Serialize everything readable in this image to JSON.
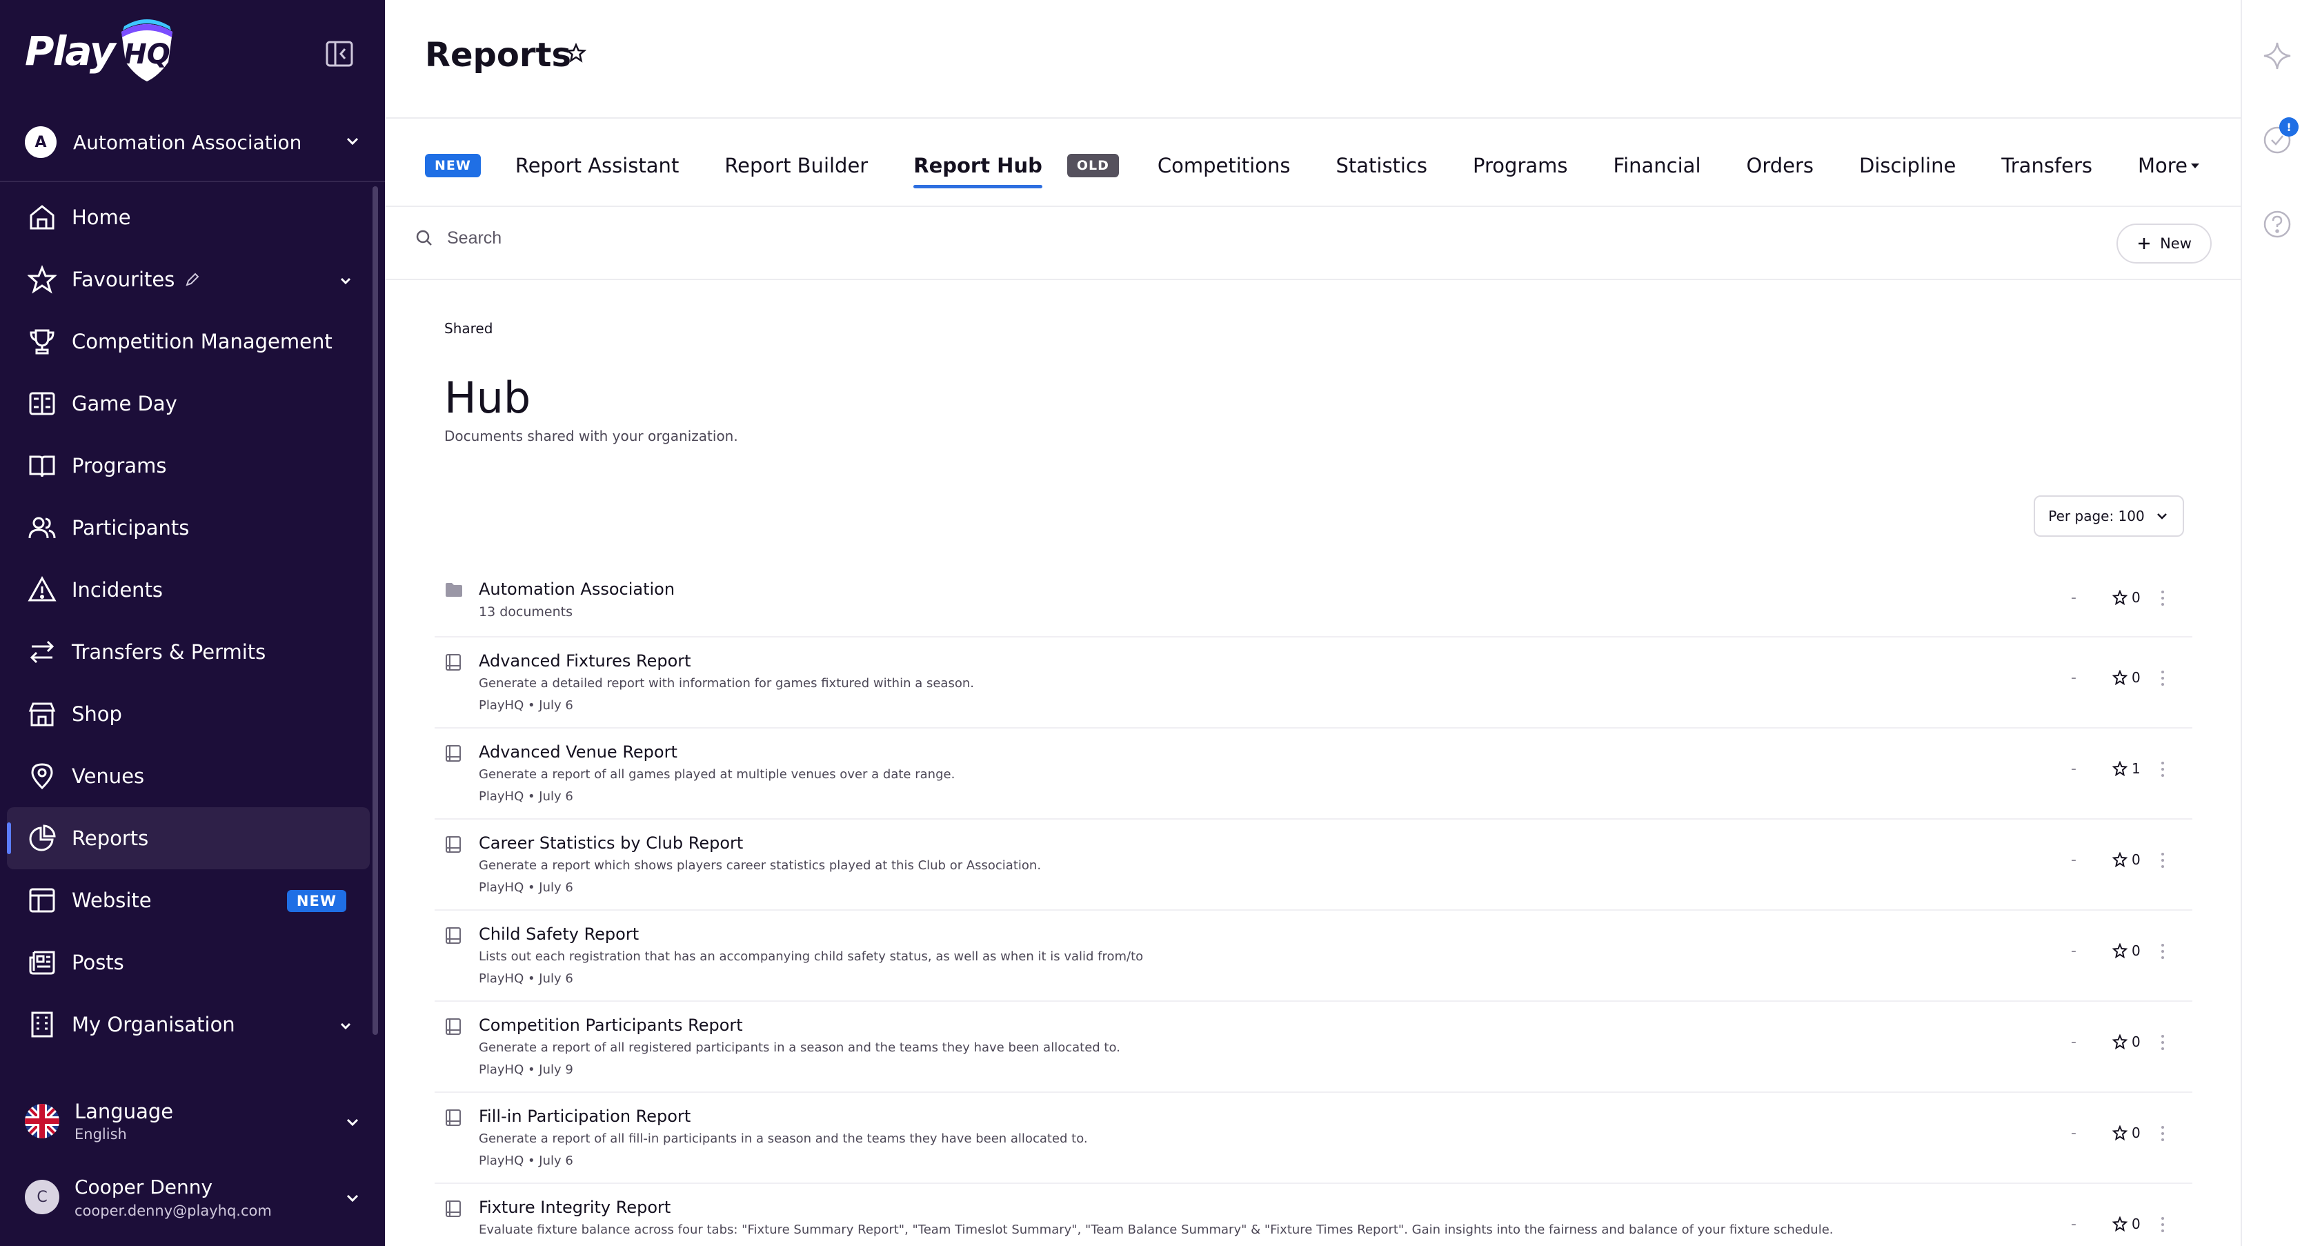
{
  "app": {
    "logo_text": "Play",
    "logo_mark": "HQ"
  },
  "sidebar": {
    "org": {
      "initial": "A",
      "name": "Automation Association"
    },
    "items": [
      {
        "label": "Home",
        "icon": "home-icon"
      },
      {
        "label": "Favourites",
        "icon": "star-icon"
      },
      {
        "label": "Competition Management",
        "icon": "trophy-icon"
      },
      {
        "label": "Game Day",
        "icon": "scoreboard-icon"
      },
      {
        "label": "Programs",
        "icon": "book-icon"
      },
      {
        "label": "Participants",
        "icon": "users-icon"
      },
      {
        "label": "Incidents",
        "icon": "warning-icon"
      },
      {
        "label": "Transfers & Permits",
        "icon": "transfer-icon"
      },
      {
        "label": "Shop",
        "icon": "shop-icon"
      },
      {
        "label": "Venues",
        "icon": "location-pin-icon"
      },
      {
        "label": "Reports",
        "icon": "pie-chart-icon"
      },
      {
        "label": "Website",
        "icon": "website-icon",
        "badge": "NEW"
      },
      {
        "label": "Posts",
        "icon": "newspaper-icon"
      },
      {
        "label": "My Organisation",
        "icon": "building-icon"
      }
    ],
    "language": {
      "title": "Language",
      "value": "English"
    },
    "user": {
      "initial": "C",
      "name": "Cooper Denny",
      "email": "cooper.denny@playhq.com"
    }
  },
  "header": {
    "title": "Reports"
  },
  "tabs": {
    "new_badge": "NEW",
    "old_badge": "OLD",
    "items": [
      "Report Assistant",
      "Report Builder",
      "Report Hub",
      "Competitions",
      "Statistics",
      "Programs",
      "Financial",
      "Orders",
      "Discipline",
      "Transfers",
      "More"
    ],
    "active": "Report Hub"
  },
  "search": {
    "placeholder": "Search"
  },
  "new_button": {
    "label": "New"
  },
  "hub": {
    "section": "Shared",
    "title": "Hub",
    "description": "Documents shared with your organization.",
    "per_page": "Per page: 100"
  },
  "documents": [
    {
      "type": "folder",
      "title": "Automation Association",
      "sub": "13 documents",
      "dash": "-",
      "stars": "0"
    },
    {
      "type": "report",
      "title": "Advanced Fixtures Report",
      "desc": "Generate a detailed report with information for games fixtured within a season.",
      "meta": "PlayHQ • July 6",
      "dash": "-",
      "stars": "0"
    },
    {
      "type": "report",
      "title": "Advanced Venue Report",
      "desc": "Generate a report of all games played at multiple venues over a date range.",
      "meta": "PlayHQ • July 6",
      "dash": "-",
      "stars": "1"
    },
    {
      "type": "report",
      "title": "Career Statistics by Club Report",
      "desc": "Generate a report which shows players career statistics played at this Club or Association.",
      "meta": "PlayHQ • July 6",
      "dash": "-",
      "stars": "0"
    },
    {
      "type": "report",
      "title": "Child Safety Report",
      "desc": "Lists out each registration that has an accompanying child safety status, as well as when it is valid from/to",
      "meta": "PlayHQ • July 6",
      "dash": "-",
      "stars": "0"
    },
    {
      "type": "report",
      "title": "Competition Participants Report",
      "desc": "Generate a report of all registered participants in a season and the teams they have been allocated to.",
      "meta": "PlayHQ • July 9",
      "dash": "-",
      "stars": "0"
    },
    {
      "type": "report",
      "title": "Fill-in Participation Report",
      "desc": "Generate a report of all fill-in participants in a season and the teams they have been allocated to.",
      "meta": "PlayHQ • July 6",
      "dash": "-",
      "stars": "0"
    },
    {
      "type": "report",
      "title": "Fixture Integrity Report",
      "desc": "Evaluate fixture balance across four tabs: \"Fixture Summary Report\", \"Team Timeslot Summary\", \"Team Balance Summary\" & \"Fixture Times Report\". Gain insights into the fairness and balance of your fixture schedule.",
      "meta": "",
      "dash": "-",
      "stars": "0"
    }
  ],
  "rail": {
    "notification_count": "!"
  },
  "colors": {
    "sidebar_bg": "#1c0e39",
    "accent": "#1f6fe5",
    "active_tab_underline": "#2e6fe0"
  }
}
